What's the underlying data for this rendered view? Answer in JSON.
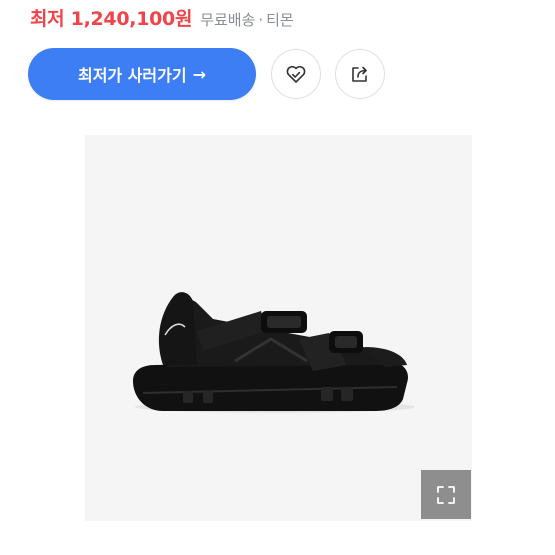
{
  "offer": {
    "price": "최저 1,240,100원",
    "shipping": "무료배송",
    "separator": "·",
    "seller": "티몬"
  },
  "actions": {
    "buy_label": "최저가 사러가기",
    "buy_arrow": "→",
    "wishlist_icon": "heart-check-icon",
    "share_icon": "share-icon"
  },
  "product_image": {
    "subject": "black strap sandal",
    "zoom_icon": "expand-icon"
  },
  "colors": {
    "price": "#f0434a",
    "cta": "#3d7ef5",
    "muted_text": "#8a8f97",
    "image_bg": "#f5f5f5",
    "zoom_bg": "#8e8e8e"
  }
}
